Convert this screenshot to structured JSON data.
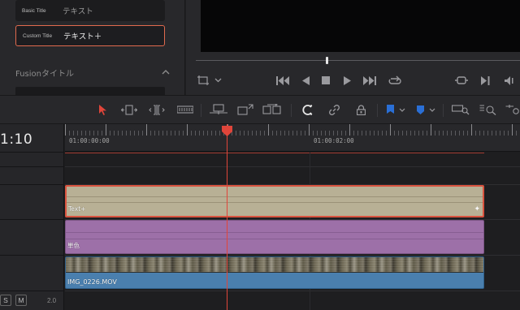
{
  "effects_panel": {
    "items": [
      {
        "tag": "Basic Title",
        "name": "テキスト",
        "selected": false
      },
      {
        "tag": "Custom Title",
        "name": "テキスト＋",
        "selected": true
      }
    ],
    "section_header": "Fusionタイトル"
  },
  "viewer": {
    "scrub_position": 0.4,
    "controls": [
      "crop-icon",
      "chevron-down-icon",
      "skip-back-icon",
      "play-reverse-icon",
      "stop-icon",
      "play-icon",
      "skip-forward-icon",
      "loop-icon",
      "match-frame-icon",
      "next-edit-icon",
      "volume-icon"
    ]
  },
  "toolbar": {
    "tools": [
      "select-arrow-icon",
      "trim-icon",
      "dynamic-trim-icon",
      "blade-icon",
      "insert-clip-icon",
      "overwrite-clip-icon",
      "replace-clip-icon",
      "snapping-icon",
      "link-icon",
      "lock-icon",
      "flag-icon",
      "marker-icon",
      "zoom-full-icon",
      "zoom-detail-icon",
      "zoom-custom-icon"
    ],
    "accent_color": "#e0453a",
    "flag_color": "#2a6fd6",
    "marker_color": "#2a6fd6"
  },
  "timeline": {
    "timecode": "1:10",
    "ruler_labels": [
      "01:00:00:00",
      "01:00:02:00"
    ],
    "playhead_color": "#e0453a",
    "clips": [
      {
        "label": "Text+",
        "type": "title",
        "color": "#b8b095",
        "selected": true
      },
      {
        "label": "単色",
        "type": "solid",
        "color": "#9d70a8",
        "selected": false
      },
      {
        "label": "IMG_0226.MOV",
        "type": "video",
        "color": "#4a7fae",
        "selected": false
      }
    ],
    "track_buttons": [
      "S",
      "M"
    ],
    "audio_level": "2.0"
  }
}
